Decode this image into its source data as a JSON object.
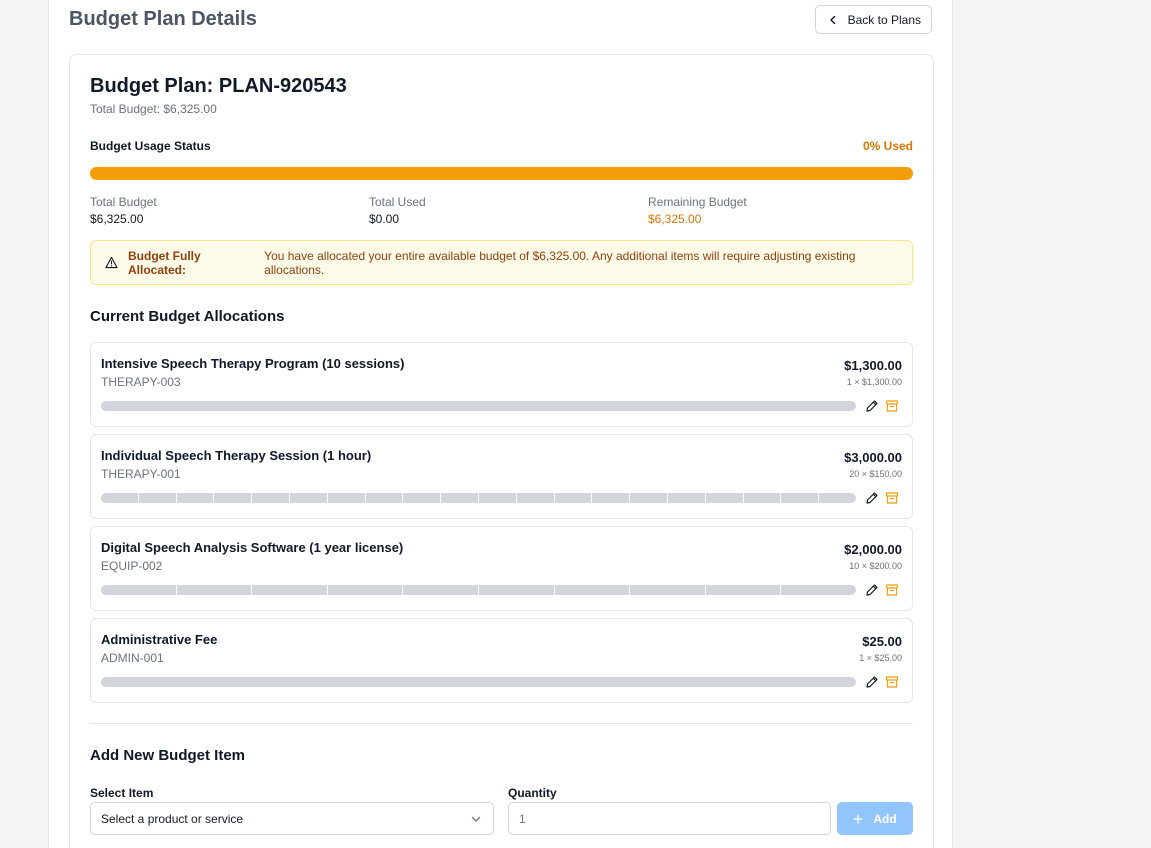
{
  "page": {
    "title": "Budget Plan Details",
    "back_label": "Back to Plans"
  },
  "plan": {
    "title": "Budget Plan: PLAN-920543",
    "total_budget_text": "Total Budget: $6,325.00",
    "usage_label": "Budget Usage Status",
    "usage_pct_text": "0% Used",
    "usage_fraction": 0.0,
    "stats": [
      {
        "label": "Total Budget",
        "value": "$6,325.00"
      },
      {
        "label": "Total Used",
        "value": "$0.00"
      },
      {
        "label": "Remaining Budget",
        "value": "$6,325.00"
      }
    ],
    "alert": {
      "title": "Budget Fully Allocated:",
      "message": "You have allocated your entire available budget of $6,325.00. Any additional items will require adjusting existing allocations."
    }
  },
  "allocations": {
    "title": "Current Budget Allocations",
    "items": [
      {
        "name": "Intensive Speech Therapy Program (10 sessions)",
        "code": "THERAPY-003",
        "total": "$1,300.00",
        "calc": "1 × $1,300.00",
        "units": 1
      },
      {
        "name": "Individual Speech Therapy Session (1 hour)",
        "code": "THERAPY-001",
        "total": "$3,000.00",
        "calc": "20 × $150.00",
        "units": 20
      },
      {
        "name": "Digital Speech Analysis Software (1 year license)",
        "code": "EQUIP-002",
        "total": "$2,000.00",
        "calc": "10 × $200.00",
        "units": 10
      },
      {
        "name": "Administrative Fee",
        "code": "ADMIN-001",
        "total": "$25.00",
        "calc": "1 × $25.00",
        "units": 1
      }
    ]
  },
  "add_item": {
    "title": "Add New Budget Item",
    "select_label": "Select Item",
    "select_value": "Select a product or service",
    "quantity_label": "Quantity",
    "quantity_placeholder": "1",
    "add_label": "Add"
  },
  "colors": {
    "accent": "#f59e0b",
    "warning_text": "#92400e",
    "add_button": "#93c5fd",
    "archive_icon": "#f59e0b"
  },
  "icons": {
    "back": "chevron-left-icon",
    "alert": "warning-triangle-icon",
    "edit": "pencil-icon",
    "archive": "archive-icon",
    "select": "chevron-down-icon",
    "add": "plus-icon"
  }
}
